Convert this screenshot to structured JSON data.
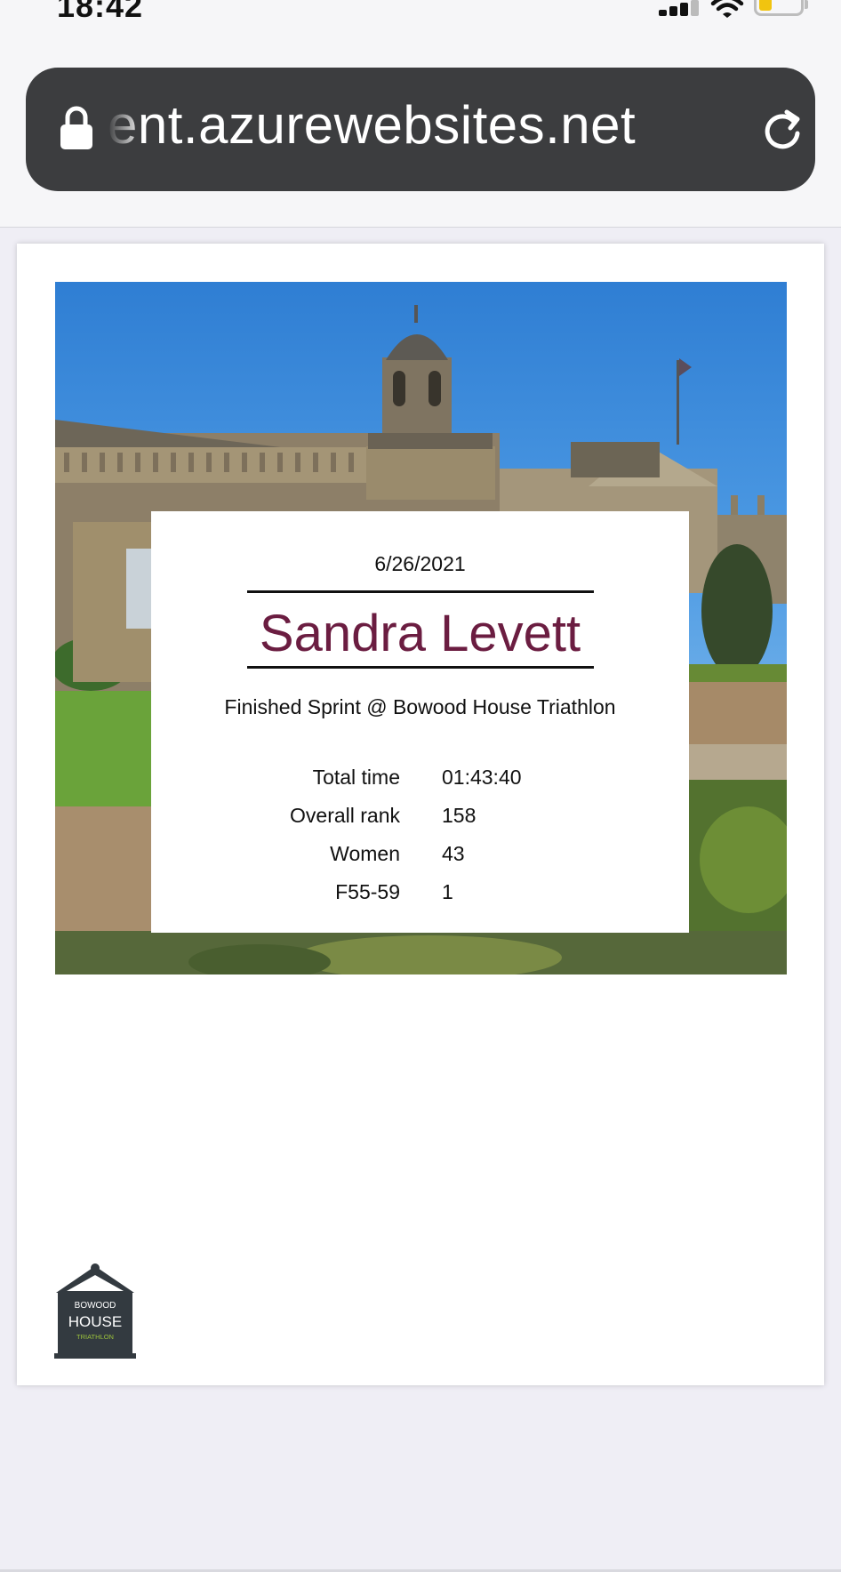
{
  "status_bar": {
    "time": "18:42"
  },
  "browser": {
    "url": "ent.azurewebsites.net"
  },
  "result": {
    "date": "6/26/2021",
    "athlete": "Sandra Levett",
    "finished": "Finished Sprint @ Bowood House Triathlon",
    "stats": [
      {
        "label": "Total time",
        "value": "01:43:40"
      },
      {
        "label": "Overall rank",
        "value": "158"
      },
      {
        "label": "Women",
        "value": "43"
      },
      {
        "label": "F55-59",
        "value": "1"
      }
    ]
  },
  "logo": {
    "line1": "BOWOOD",
    "line2": "HOUSE",
    "line3": "TRIATHLON"
  },
  "colors": {
    "name": "#6b1d41",
    "url_bar": "#3c3d3f",
    "logo_dark": "#333a40",
    "logo_green": "#9bc23c"
  },
  "icons": [
    "lock-icon",
    "reload-icon",
    "signal-icon",
    "wifi-icon",
    "battery-icon"
  ]
}
